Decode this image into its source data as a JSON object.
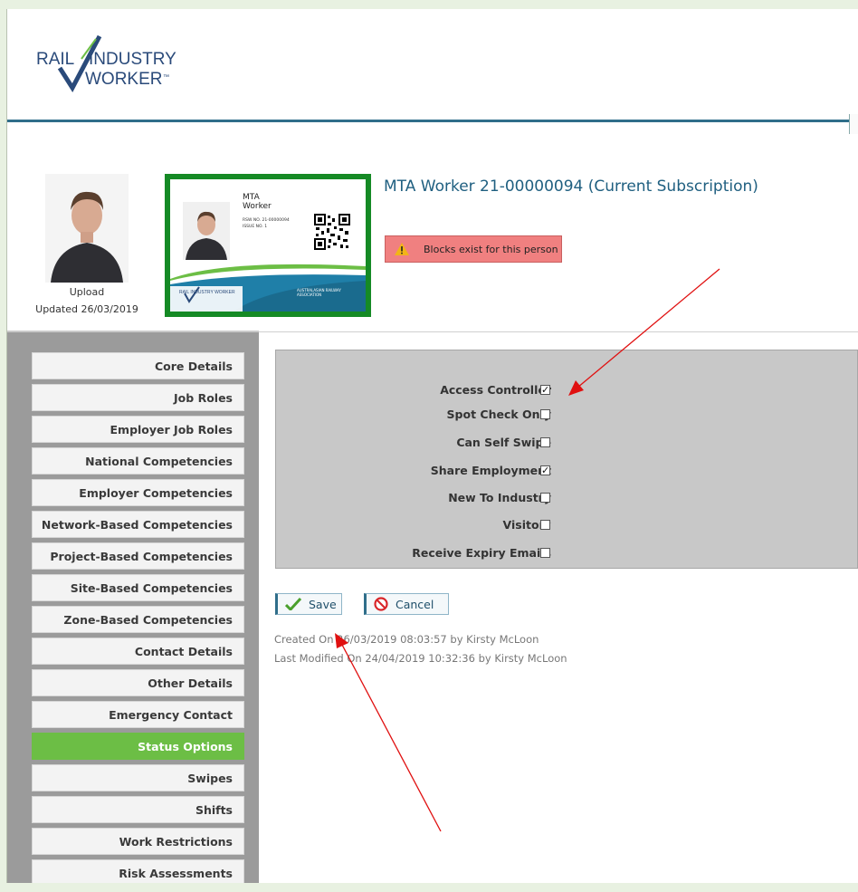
{
  "logo": {
    "line1": "RAIL",
    "line1b": "INDUSTRY",
    "line2": "WORKER",
    "tm": "™"
  },
  "profile": {
    "upload_label": "Upload",
    "updated_label": "Updated 26/03/2019"
  },
  "card": {
    "name_line1": "MTA",
    "name_line2": "Worker",
    "rsw_no": "RSW NO. 21-00000094",
    "issue_no": "ISSUE NO. 1",
    "footer_logo": "RAIL INDUSTRY WORKER",
    "association": "AUSTRALASIAN RAILWAY ASSOCIATION",
    "colors": {
      "frame": "#158a25",
      "wave_blue": "#1f7fa8",
      "wave_green": "#6cbe45"
    }
  },
  "page_title": "MTA Worker 21-00000094 (Current Subscription)",
  "alert": {
    "text": "Blocks exist for this person",
    "icon": "warning-icon"
  },
  "sidebar": {
    "items": [
      {
        "label": "Core Details",
        "active": false
      },
      {
        "label": "Job Roles",
        "active": false
      },
      {
        "label": "Employer Job Roles",
        "active": false
      },
      {
        "label": "National Competencies",
        "active": false
      },
      {
        "label": "Employer Competencies",
        "active": false
      },
      {
        "label": "Network-Based Competencies",
        "active": false
      },
      {
        "label": "Project-Based Competencies",
        "active": false
      },
      {
        "label": "Site-Based Competencies",
        "active": false
      },
      {
        "label": "Zone-Based Competencies",
        "active": false
      },
      {
        "label": "Contact Details",
        "active": false
      },
      {
        "label": "Other Details",
        "active": false
      },
      {
        "label": "Emergency Contact",
        "active": false
      },
      {
        "label": "Status Options",
        "active": true
      },
      {
        "label": "Swipes",
        "active": false
      },
      {
        "label": "Shifts",
        "active": false
      },
      {
        "label": "Work Restrictions",
        "active": false
      },
      {
        "label": "Risk Assessments",
        "active": false
      }
    ]
  },
  "status_options": [
    {
      "label": "Access Controller",
      "checked": true
    },
    {
      "label": "Spot Check Only",
      "checked": false
    },
    {
      "label": "Can Self Swipe",
      "checked": false
    },
    {
      "label": "Share Employment",
      "checked": true
    },
    {
      "label": "New To Industry",
      "checked": false
    },
    {
      "label": "Visitor?",
      "checked": false
    },
    {
      "label": "Receive Expiry Emails",
      "checked": false
    }
  ],
  "actions": {
    "save_label": "Save",
    "cancel_label": "Cancel"
  },
  "audit": {
    "created": "Created On 26/03/2019 08:03:57 by Kirsty McLoon",
    "modified": "Last Modified On 24/04/2019 10:32:36 by Kirsty McLoon"
  },
  "colors": {
    "accent_blue": "#2f6e8a",
    "active_green": "#6cbe45",
    "alert_red": "#f08080",
    "annotation_arrow": "#e01010"
  }
}
